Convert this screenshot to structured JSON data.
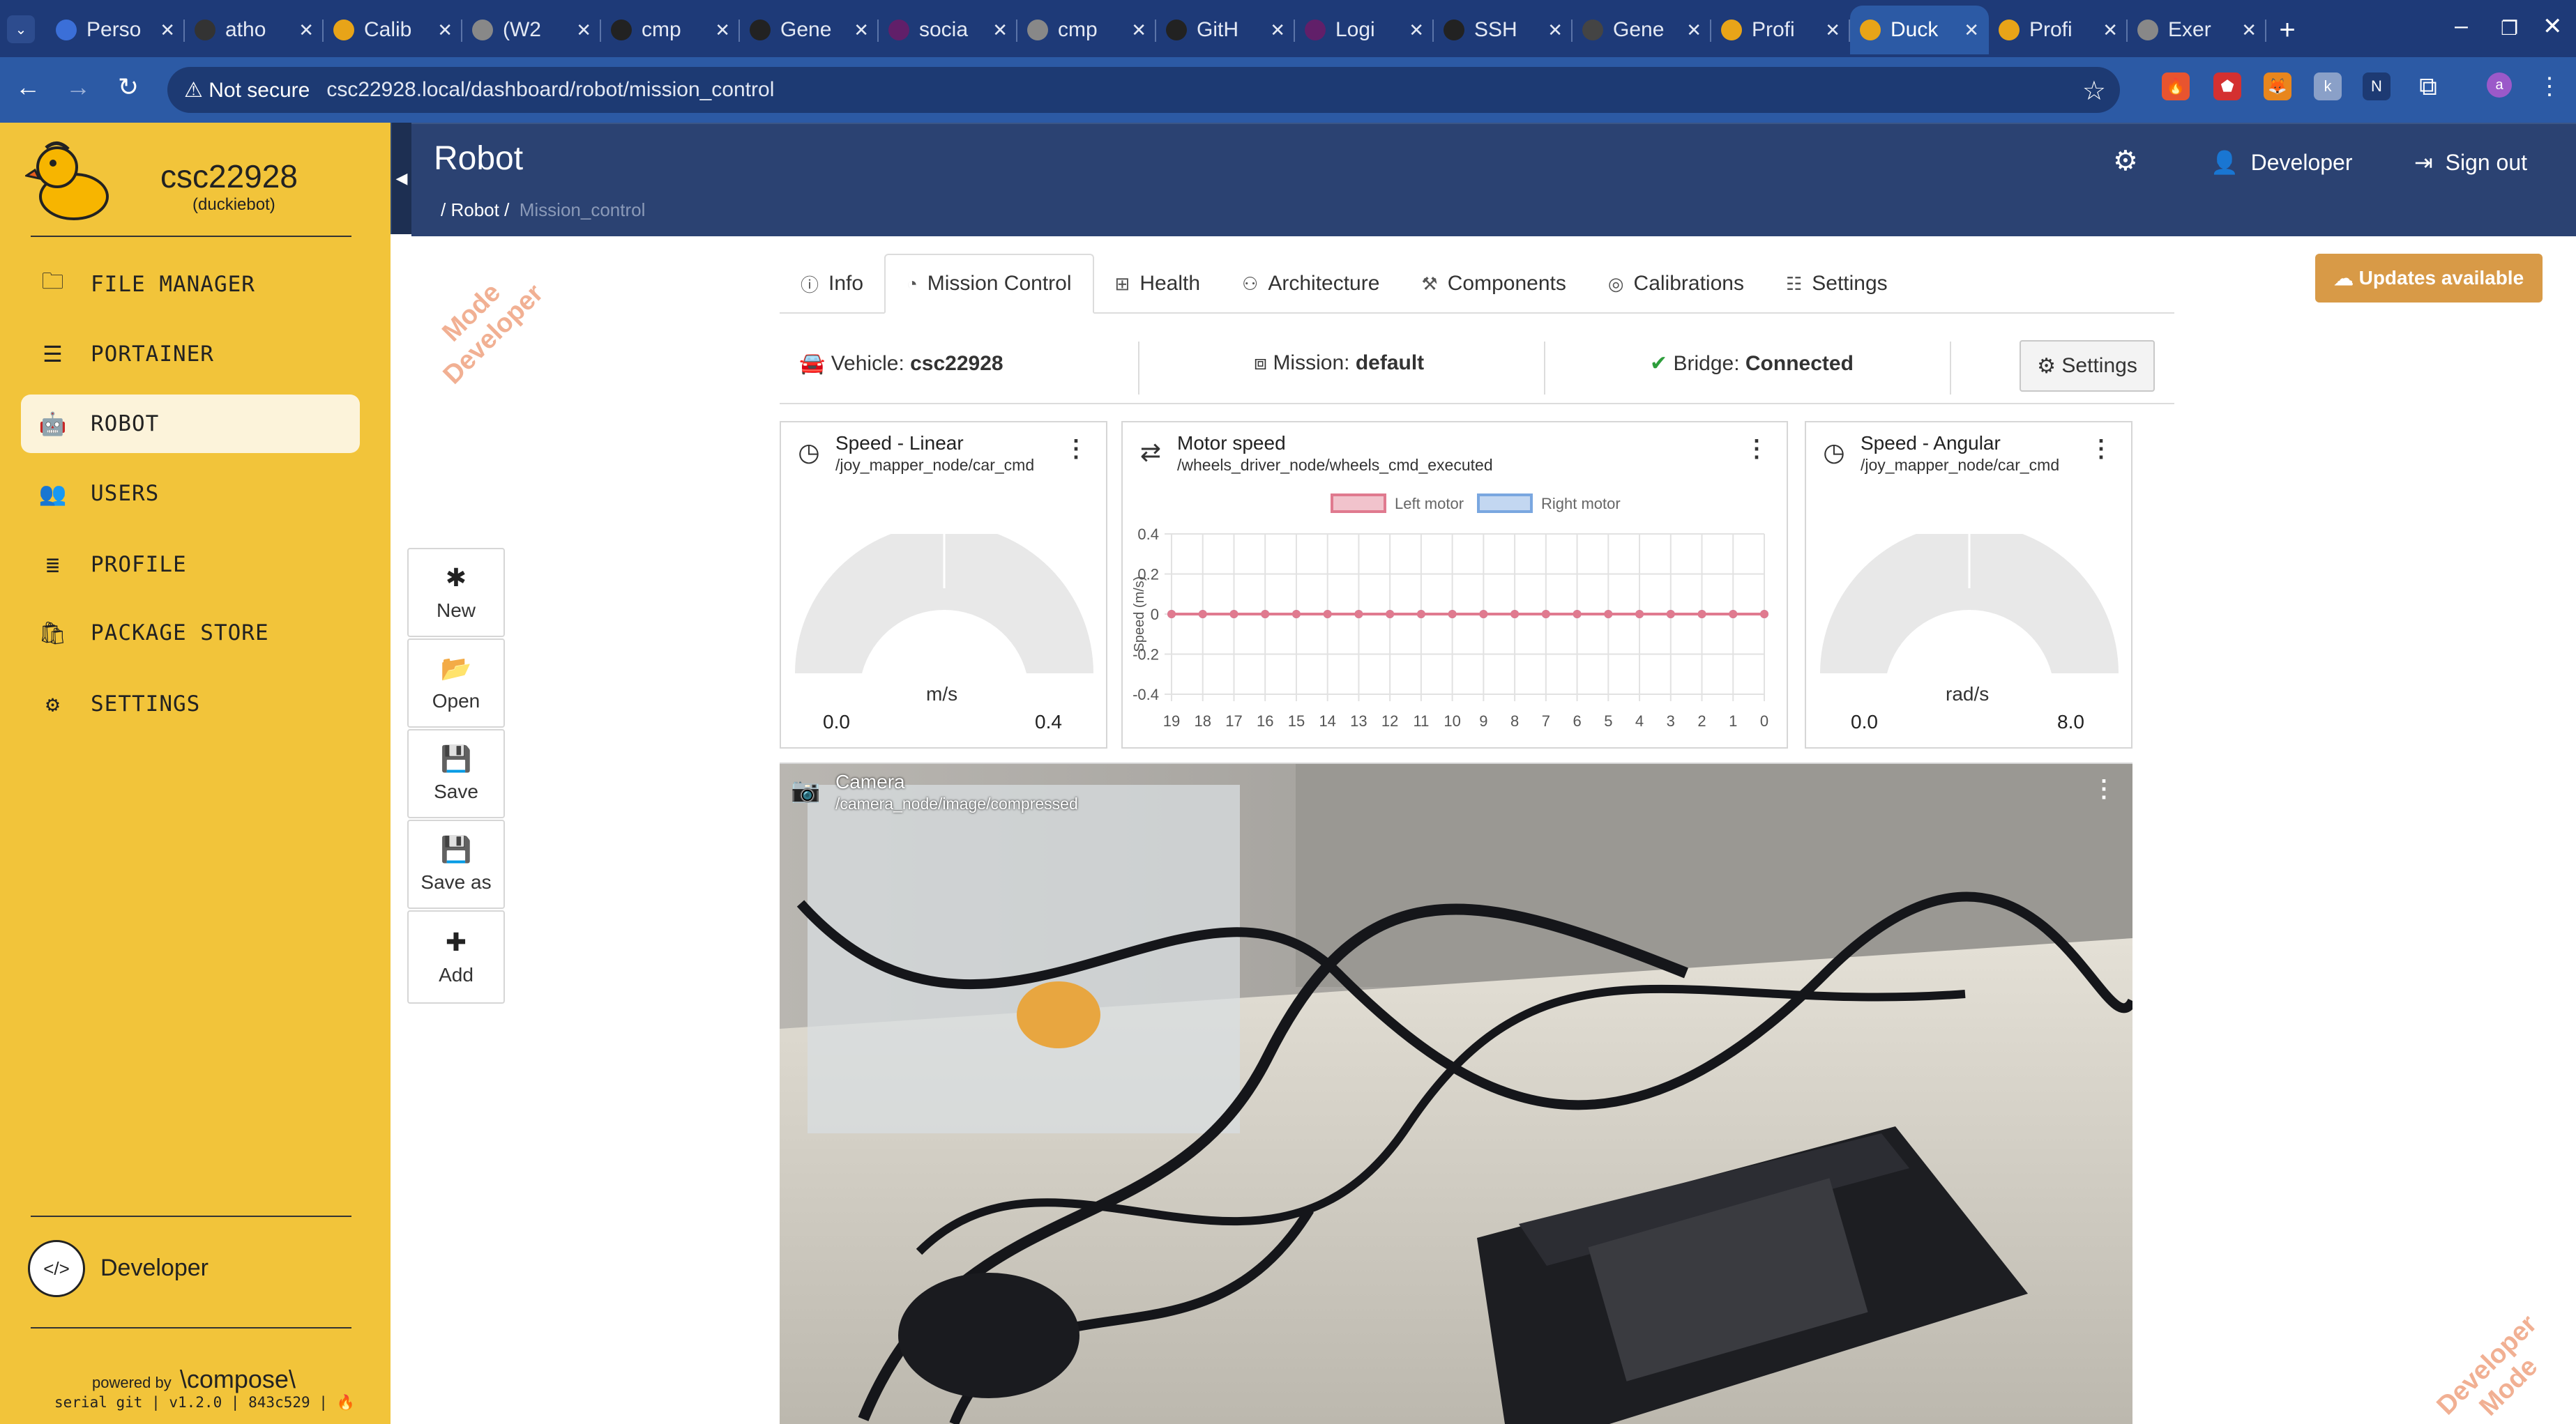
{
  "browser": {
    "tabs": [
      {
        "title": "Perso",
        "color": "#3b6fd8"
      },
      {
        "title": "atho",
        "color": "#333333"
      },
      {
        "title": "Calib",
        "color": "#e8a418"
      },
      {
        "title": "(W2",
        "color": "#888888"
      },
      {
        "title": "cmp",
        "color": "#222222"
      },
      {
        "title": "Gene",
        "color": "#222222"
      },
      {
        "title": "socia",
        "color": "#611f69"
      },
      {
        "title": "cmp",
        "color": "#888888"
      },
      {
        "title": "GitH",
        "color": "#222222"
      },
      {
        "title": "Logi",
        "color": "#611f69"
      },
      {
        "title": "SSH",
        "color": "#222222"
      },
      {
        "title": "Gene",
        "color": "#444444"
      },
      {
        "title": "Profi",
        "color": "#e8a418"
      },
      {
        "title": "Duck",
        "color": "#e8a418"
      },
      {
        "title": "Profi",
        "color": "#e8a418"
      },
      {
        "title": "Exer",
        "color": "#888888"
      }
    ],
    "active_tab_index": 13,
    "security_label": "Not secure",
    "url": "csc22928.local/dashboard/robot/mission_control"
  },
  "sidebar": {
    "hostname": "csc22928",
    "host_type": "(duckiebot)",
    "items": [
      {
        "label": "FILE MANAGER",
        "icon": "folder-icon"
      },
      {
        "label": "PORTAINER",
        "icon": "sliders-icon"
      },
      {
        "label": "ROBOT",
        "icon": "android-icon",
        "active": true
      },
      {
        "label": "USERS",
        "icon": "users-icon"
      },
      {
        "label": "PROFILE",
        "icon": "list-icon"
      },
      {
        "label": "PACKAGE STORE",
        "icon": "store-icon"
      },
      {
        "label": "SETTINGS",
        "icon": "gear-icon"
      }
    ],
    "user_label": "Developer",
    "powered_by": "powered by",
    "brand": "\\compose\\",
    "version_line": "serial git | v1.2.0 | 843c529 |"
  },
  "header": {
    "title": "Robot",
    "breadcrumb": [
      "Robot",
      "Mission_control"
    ],
    "user": "Developer",
    "signout": "Sign out"
  },
  "watermark": {
    "line1": "Mode",
    "line2": "Developer",
    "b_line1": "Developer",
    "b_line2": "Mode"
  },
  "updates_button": "Updates available",
  "toolbox": [
    {
      "label": "New",
      "icon": "asterisk-icon"
    },
    {
      "label": "Open",
      "icon": "folder-open-icon"
    },
    {
      "label": "Save",
      "icon": "floppy-icon"
    },
    {
      "label": "Save as",
      "icon": "floppy-plus-icon"
    },
    {
      "label": "Add",
      "icon": "plus-icon"
    }
  ],
  "tabs": [
    {
      "label": "Info",
      "icon": "info-icon"
    },
    {
      "label": "Mission Control",
      "icon": "dashboard-icon",
      "active": true
    },
    {
      "label": "Health",
      "icon": "medkit-icon"
    },
    {
      "label": "Architecture",
      "icon": "sitemap-icon"
    },
    {
      "label": "Components",
      "icon": "puzzle-icon"
    },
    {
      "label": "Calibrations",
      "icon": "target-icon"
    },
    {
      "label": "Settings",
      "icon": "settings-sliders-icon"
    }
  ],
  "status": {
    "vehicle_label": "Vehicle:",
    "vehicle": "csc22928",
    "mission_label": "Mission:",
    "mission": "default",
    "bridge_label": "Bridge:",
    "bridge": "Connected",
    "bridge_color": "#2e9e3c",
    "settings_button": "Settings"
  },
  "panels": {
    "linear": {
      "title": "Speed - Linear",
      "topic": "/joy_mapper_node/car_cmd",
      "unit": "m/s",
      "min": "0.0",
      "max": "0.4",
      "value": 0
    },
    "motor": {
      "title": "Motor speed",
      "topic": "/wheels_driver_node/wheels_cmd_executed"
    },
    "angular": {
      "title": "Speed - Angular",
      "topic": "/joy_mapper_node/car_cmd",
      "unit": "rad/s",
      "min": "0.0",
      "max": "8.0",
      "value": 0
    },
    "camera": {
      "title": "Camera",
      "topic": "/camera_node/image/compressed"
    }
  },
  "chart_data": {
    "type": "line",
    "x": [
      19,
      18,
      17,
      16,
      15,
      14,
      13,
      12,
      11,
      10,
      9,
      8,
      7,
      6,
      5,
      4,
      3,
      2,
      1,
      0
    ],
    "series": [
      {
        "name": "Left motor",
        "color": "#e07a8f",
        "values": [
          0,
          0,
          0,
          0,
          0,
          0,
          0,
          0,
          0,
          0,
          0,
          0,
          0,
          0,
          0,
          0,
          0,
          0,
          0,
          0
        ]
      },
      {
        "name": "Right motor",
        "color": "#7aa7e0",
        "values": [
          0,
          0,
          0,
          0,
          0,
          0,
          0,
          0,
          0,
          0,
          0,
          0,
          0,
          0,
          0,
          0,
          0,
          0,
          0,
          0
        ]
      }
    ],
    "ylabel": "Speed (m/s)",
    "ylim": [
      -0.4,
      0.4
    ],
    "yticks": [
      "0.4",
      "0.2",
      "0",
      "-0.2",
      "-0.4"
    ],
    "grid": true,
    "legend": "top"
  }
}
